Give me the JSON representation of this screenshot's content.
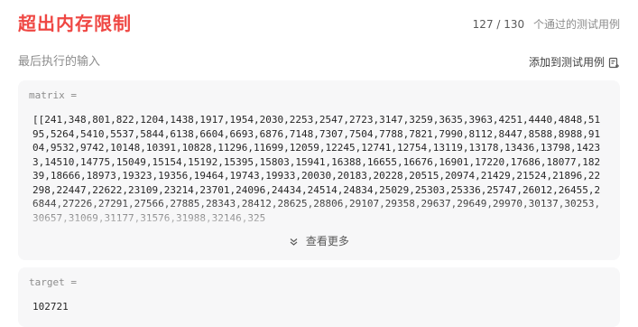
{
  "header": {
    "title": "超出内存限制",
    "passed": "127 / 130",
    "passed_suffix": "个通过的测试用例"
  },
  "subhead": {
    "label": "最后执行的输入",
    "add_case": "添加到测试用例"
  },
  "inputs": {
    "matrix_label": "matrix =",
    "matrix_value": "[[241,348,801,822,1204,1438,1917,1954,2030,2253,2547,2723,3147,3259,3635,3963,4251,4440,4848,5195,5264,5410,5537,5844,6138,6604,6693,6876,7148,7307,7504,7788,7821,7990,8112,8447,8588,8988,9104,9532,9742,10148,10391,10828,11296,11699,12059,12245,12741,12754,13119,13178,13436,13798,14233,14510,14775,15049,15154,15192,15395,15803,15941,16388,16655,16676,16901,17220,17686,18077,18239,18666,18973,19323,19356,19464,19743,19933,20030,20183,20228,20515,20974,21429,21524,21896,22298,22447,22622,23109,23214,23701,24096,24434,24514,24834,25029,25303,25336,25747,26012,26455,26844,27226,27291,27566,27885,28343,28412,28625,28806,29107,29358,29637,29649,29970,30137,30253,30657,31069,31177,31576,31988,32146,325",
    "show_more": "查看更多",
    "target_label": "target =",
    "target_value": "102721"
  },
  "colors": {
    "error_title": "#ef4743",
    "card_bg": "#f7f7f8"
  }
}
